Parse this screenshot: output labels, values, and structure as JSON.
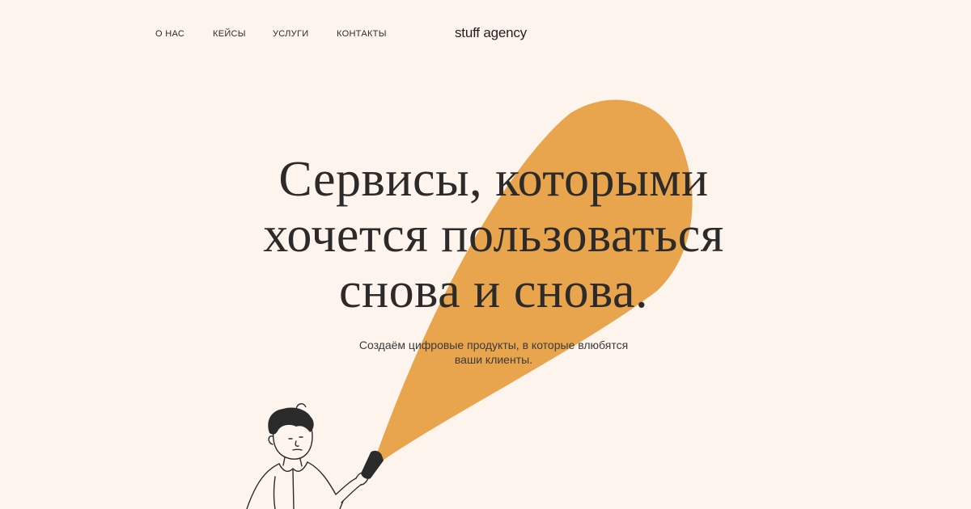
{
  "nav": {
    "items": [
      {
        "label": "О НАС"
      },
      {
        "label": "КЕЙСЫ"
      },
      {
        "label": "УСЛУГИ"
      },
      {
        "label": "КОНТАКТЫ"
      }
    ]
  },
  "brand": {
    "logo": "stuff agency"
  },
  "hero": {
    "headline_lines": [
      "Сервисы, которыми",
      "хочется пользоваться",
      "снова и снова."
    ],
    "subtitle": "Создаём цифровые продукты, в которые влюбятся ваши клиенты."
  },
  "colors": {
    "background": "#fdf5ed",
    "beam": "#e9a54d",
    "text": "#2c2b29"
  }
}
